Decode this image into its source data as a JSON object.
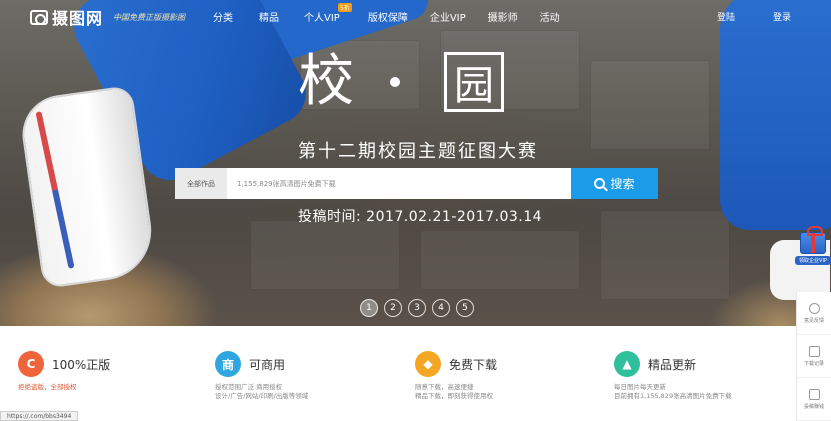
{
  "header": {
    "logo_text": "摄图网",
    "slogan": "中国免费正版摄影图",
    "nav": [
      {
        "label": "分类"
      },
      {
        "label": "精品"
      },
      {
        "label": "个人VIP",
        "badge": "5折"
      },
      {
        "label": "版权保障"
      },
      {
        "label": "企业VIP"
      },
      {
        "label": "摄影师"
      },
      {
        "label": "活动"
      }
    ],
    "login": "登陆",
    "register": "登录"
  },
  "hero": {
    "title_left": "校",
    "title_right": "园",
    "subtitle": "第十二期校园主题征图大赛",
    "dates": "投稿时间:  2017.02.21-2017.03.14",
    "search": {
      "category": "全部作品",
      "placeholder": "1,155,829张高清图片免费下载",
      "button": "搜索"
    },
    "pages": [
      "1",
      "2",
      "3",
      "4",
      "5"
    ],
    "active_page": 1
  },
  "gift": {
    "label": "领取企业VIP"
  },
  "rail": [
    {
      "label": "意见反馈",
      "icon": "feedback-icon"
    },
    {
      "label": "下载记录",
      "icon": "download-icon"
    },
    {
      "label": "投稿赚钱",
      "icon": "edit-icon"
    }
  ],
  "features": [
    {
      "icon_text": "C",
      "color": "#f0643c",
      "title": "100%正版",
      "lines": [
        "拒绝盗版，全部授权"
      ],
      "red": true
    },
    {
      "icon_text": "商",
      "color": "#2fa6e0",
      "title": "可商用",
      "lines": [
        "授权范围广泛 商用授权",
        "设计/广告/网站/印刷/出版等领域"
      ]
    },
    {
      "icon_text": "◆",
      "color": "#f5a623",
      "title": "免费下载",
      "lines": [
        "随意下载，高速便捷",
        "精品下载，即刻获得使用权"
      ]
    },
    {
      "icon_text": "▲",
      "color": "#2fbf9a",
      "title": "精品更新",
      "lines": [
        "每日图片每天更新",
        "目前拥有1,155,829张高清图片免费下载"
      ]
    }
  ],
  "status_url": "https://.com/bbs3494"
}
